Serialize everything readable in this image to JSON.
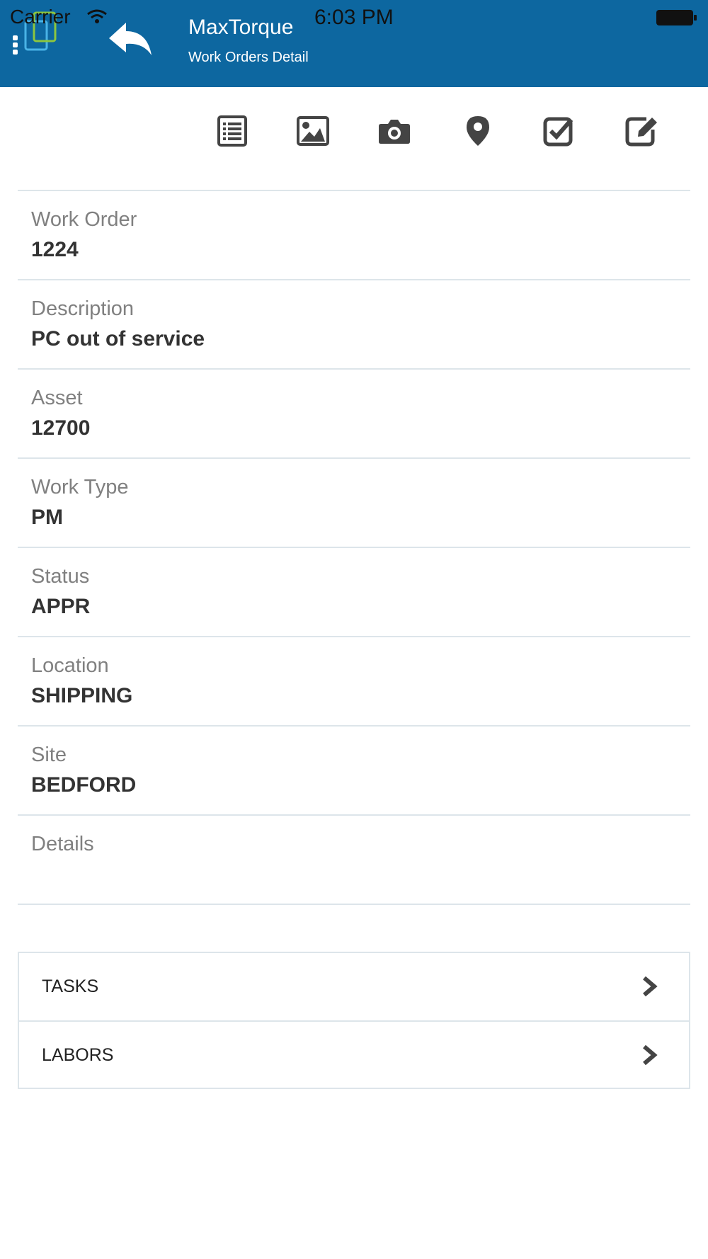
{
  "status_bar": {
    "carrier": "Carrier",
    "time": "6:03 PM"
  },
  "header": {
    "title": "MaxTorque",
    "subtitle": "Work Orders Detail",
    "background_color": "#0d67a0"
  },
  "toolbar": {
    "icons": [
      "list-icon",
      "image-icon",
      "camera-icon",
      "location-pin-icon",
      "checkbox-icon",
      "edit-icon"
    ],
    "icon_color": "#444444"
  },
  "fields": [
    {
      "label": "Work Order",
      "value": "1224"
    },
    {
      "label": "Description",
      "value": "PC out of service"
    },
    {
      "label": "Asset",
      "value": "12700"
    },
    {
      "label": "Work Type",
      "value": "PM"
    },
    {
      "label": "Status",
      "value": "APPR"
    },
    {
      "label": "Location",
      "value": "SHIPPING"
    },
    {
      "label": "Site",
      "value": "BEDFORD"
    },
    {
      "label": "Details",
      "value": ""
    }
  ],
  "nav": [
    {
      "label": "TASKS"
    },
    {
      "label": "LABORS"
    }
  ]
}
